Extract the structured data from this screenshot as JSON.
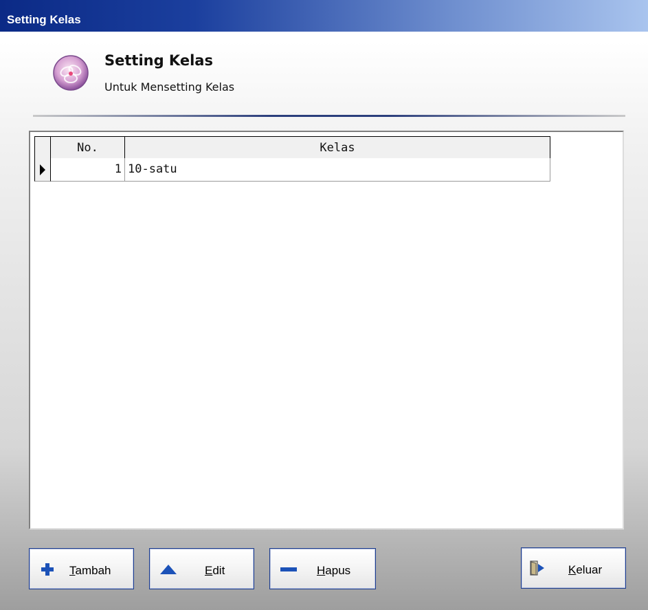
{
  "window": {
    "title": "Setting Kelas"
  },
  "header": {
    "title": "Setting Kelas",
    "subtitle": "Untuk Mensetting Kelas",
    "icon": "kelas-flower-icon"
  },
  "grid": {
    "columns": [
      "No.",
      "Kelas"
    ],
    "rows": [
      {
        "no": "1",
        "kelas": "10-satu",
        "current": true
      }
    ]
  },
  "buttons": {
    "tambah": {
      "label": "Tambah",
      "hotkey": "T",
      "rest": "ambah",
      "icon": "plus-icon",
      "color": "#1c52b8"
    },
    "edit": {
      "label": "Edit",
      "hotkey": "E",
      "rest": "dit",
      "icon": "triangle-up-icon",
      "color": "#1c52b8"
    },
    "hapus": {
      "label": "Hapus",
      "hotkey": "H",
      "rest": "apus",
      "icon": "minus-icon",
      "color": "#1c52b8"
    },
    "keluar": {
      "label": "Keluar",
      "hotkey": "K",
      "rest": "eluar",
      "icon": "exit-door-icon",
      "color": "#1c52b8"
    }
  }
}
